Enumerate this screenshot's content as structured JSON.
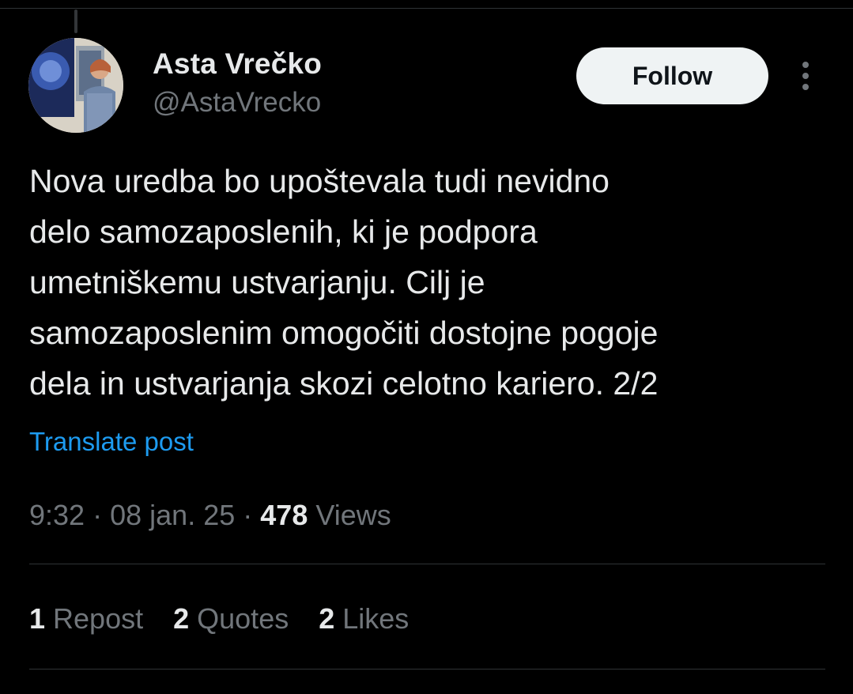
{
  "author": {
    "name": "Asta Vrečko",
    "handle": "@AstaVrecko",
    "follow_label": "Follow"
  },
  "tweet": {
    "text": "Nova uredba bo upoštevala tudi nevidno\ndelo samozaposlenih, ki je podpora\numetniškemu ustvarjanju. Cilj je\nsamozaposlenim omogočiti dostojne pogoje\ndela in ustvarjanja skozi celotno kariero. 2/2",
    "translate_label": "Translate post",
    "time": "9:32",
    "date": "08 jan. 25",
    "separator": "·",
    "views_count": "478",
    "views_label": "Views"
  },
  "stats": [
    {
      "count": "1",
      "label": "Repost"
    },
    {
      "count": "2",
      "label": "Quotes"
    },
    {
      "count": "2",
      "label": "Likes"
    }
  ],
  "colors": {
    "background": "#000000",
    "text": "#e7e9ea",
    "muted": "#71767b",
    "accent": "#1d9bf0",
    "divider": "#2f3336"
  },
  "icons": [
    "more-options-icon"
  ]
}
